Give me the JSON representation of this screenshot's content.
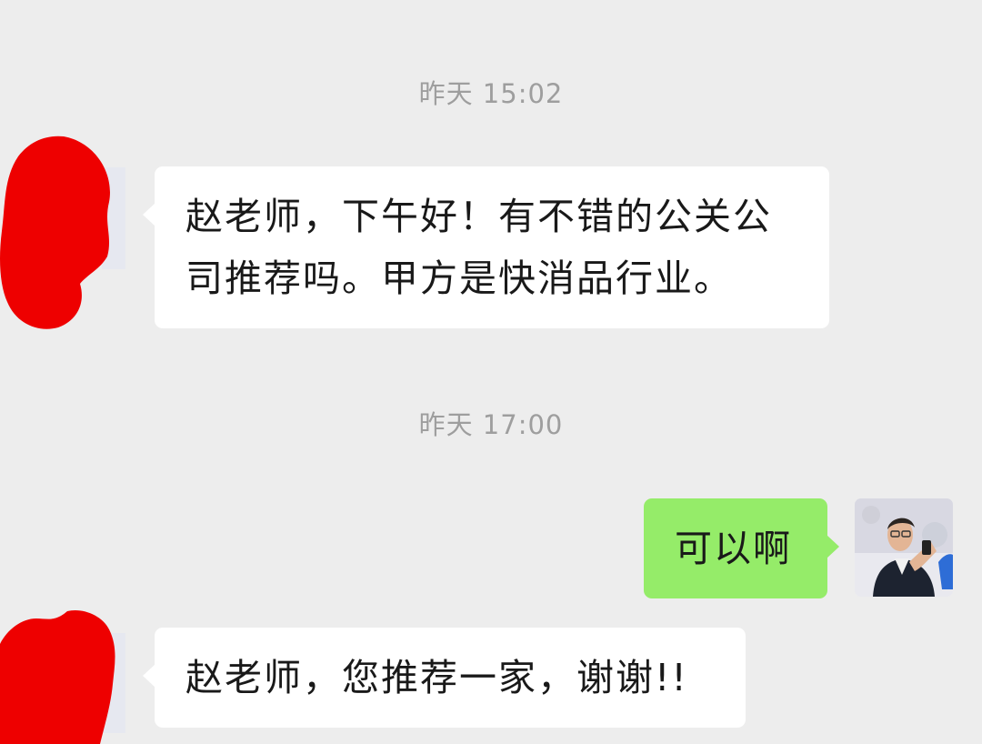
{
  "chat": {
    "timestamps": [
      "昨天 15:02",
      "昨天 17:00"
    ],
    "messages": [
      {
        "sender": "other",
        "text": "赵老师，下午好！有不错的公关公司推荐吗。甲方是快消品行业。"
      },
      {
        "sender": "self",
        "text": "可以啊"
      },
      {
        "sender": "other",
        "text": "赵老师，您推荐一家，谢谢!!"
      }
    ]
  },
  "colors": {
    "background": "#ededed",
    "incoming_bubble": "#ffffff",
    "outgoing_bubble": "#95ec69",
    "timestamp_text": "#9e9e9e",
    "redaction": "#ee0000"
  },
  "icons": {
    "contact_avatar": "redacted-avatar-icon",
    "self_avatar": "user-photo-avatar"
  }
}
